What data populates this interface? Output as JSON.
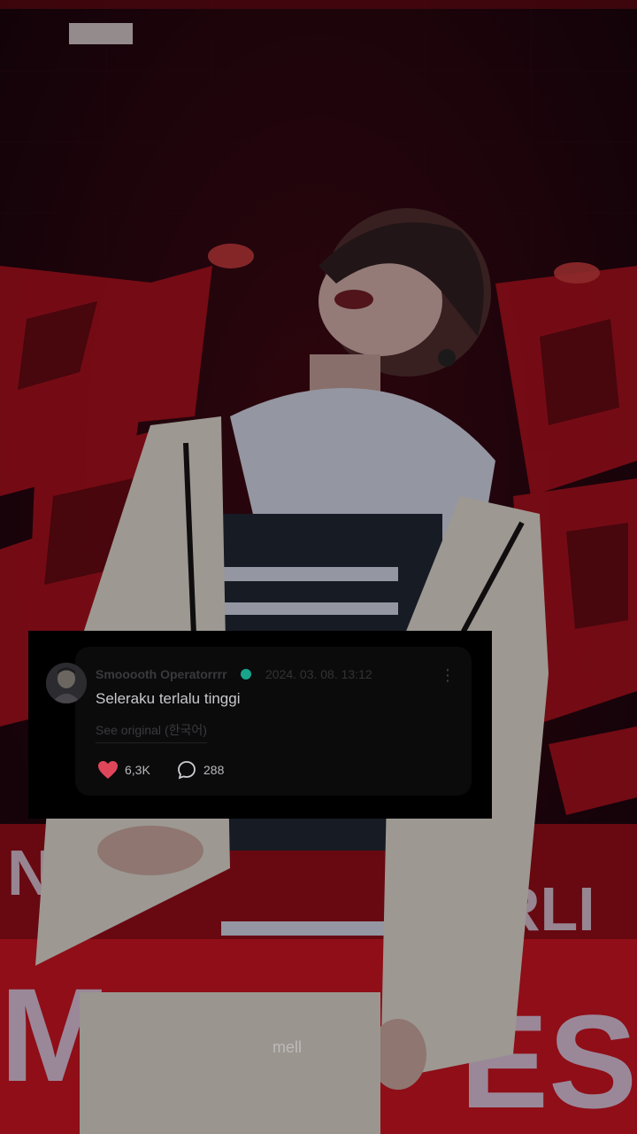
{
  "comment_card": {
    "username": "Smooooth Operatorrrr",
    "timestamp": "2024. 03. 08. 13:12",
    "comment_text": "Seleraku terlalu tinggi",
    "see_original_label": "See original",
    "original_language": "(한국어)",
    "likes_count": "6,3K",
    "replies_count": "288",
    "more_icon": "more-vertical-icon",
    "like_icon": "heart-icon",
    "reply_icon": "speech-bubble-icon"
  },
  "watermark": "mell",
  "colors": {
    "background_red": "#c0121e",
    "heart": "#e0465a",
    "verified_badge": "#18a58c",
    "card_bg": "#0b0b0c"
  }
}
